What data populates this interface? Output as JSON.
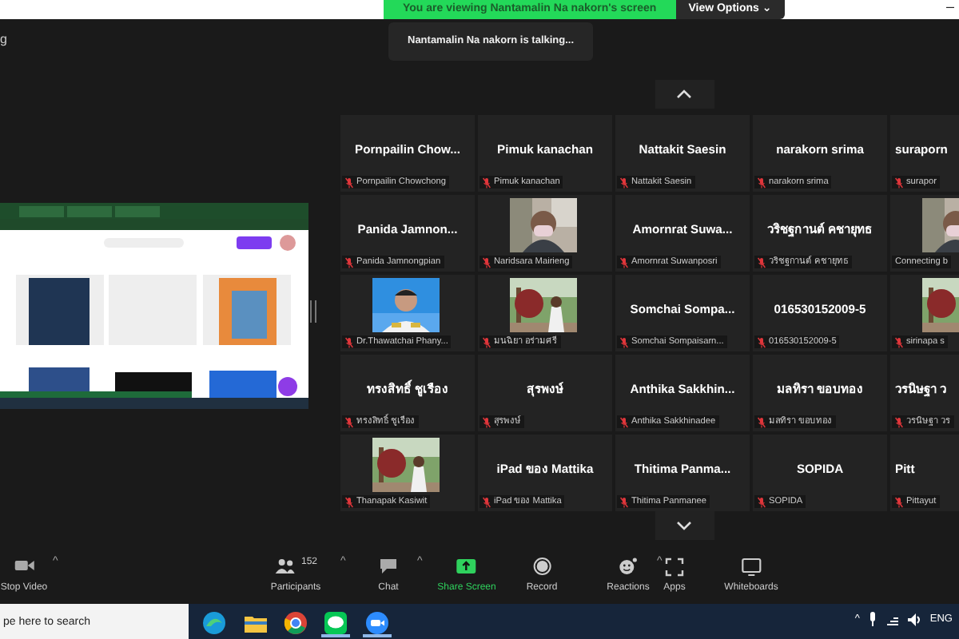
{
  "banner": {
    "text": "You are viewing Nantamalin Na nakorn's screen",
    "view_options": "View Options",
    "caret": "⌄"
  },
  "window_controls": {
    "minimize": "–"
  },
  "title_fragment": "g",
  "toast": "Nantamalin Na nakorn is talking...",
  "gallery": {
    "tiles": [
      {
        "kind": "name",
        "name": "Pornpailin  Chow...",
        "label": "Pornpailin Chowchong",
        "muted": true
      },
      {
        "kind": "name",
        "name": "Pimuk kanachan",
        "label": "Pimuk kanachan",
        "muted": true
      },
      {
        "kind": "name",
        "name": "Nattakit Saesin",
        "label": "Nattakit Saesin",
        "muted": true
      },
      {
        "kind": "name",
        "name": "narakorn srima",
        "label": "narakorn srima",
        "muted": true
      },
      {
        "kind": "name",
        "name": "suraporn",
        "label": "surapor",
        "muted": true
      },
      {
        "kind": "name",
        "name": "Panida  Jamnon...",
        "label": "Panida Jamnongpian",
        "muted": true
      },
      {
        "label": "Naridsara Mairieng",
        "muted": true
      },
      {
        "kind": "name",
        "name": "Amornrat  Suwa...",
        "label": "Amornrat Suwanposri",
        "muted": true
      },
      {
        "kind": "name",
        "name": "วริชฐกานต์ คชายุทธ",
        "label": "วริชฐกานต์ คชายุทธ",
        "muted": true
      },
      {
        "label": "Connecting b",
        "muted": false
      },
      {
        "label": "Dr.Thawatchai Phany...",
        "muted": true
      },
      {
        "label": "มนฉิยา อร่ามศรี",
        "muted": true
      },
      {
        "kind": "name",
        "name": "Somchai  Sompa...",
        "label": "Somchai Sompaisarn...",
        "muted": true
      },
      {
        "kind": "name",
        "name": "016530152009-5",
        "label": "016530152009-5",
        "muted": true
      },
      {
        "label": "sirinapa s",
        "muted": true
      },
      {
        "kind": "name",
        "name": "ทรงสิทธิ์ ชูเรือง",
        "label": "ทรงสิทธิ์ ชูเรือง",
        "muted": true
      },
      {
        "kind": "name",
        "name": "สุรพงษ์",
        "label": "สุรพงษ์",
        "muted": true
      },
      {
        "kind": "name",
        "name": "Anthika  Sakkhin...",
        "label": "Anthika Sakkhinadee",
        "muted": true
      },
      {
        "kind": "name",
        "name": "มลทิรา ขอบทอง",
        "label": "มลทิรา ขอบทอง",
        "muted": true
      },
      {
        "kind": "name",
        "name": "วรนิษฐา ว",
        "label": "วรนิษฐา วร",
        "muted": true
      },
      {
        "label": "Thanapak Kasiwit",
        "muted": true
      },
      {
        "kind": "name",
        "name": "iPad ของ Mattika",
        "label": "iPad ของ Mattika",
        "muted": true
      },
      {
        "kind": "name",
        "name": "Thitima  Panma...",
        "label": "Thitima  Panmanee",
        "muted": true
      },
      {
        "kind": "name",
        "name": "SOPIDA",
        "label": "SOPIDA",
        "muted": true
      },
      {
        "kind": "name",
        "name": "Pitt",
        "label": "Pittayut",
        "muted": true
      }
    ]
  },
  "toolbar": [
    {
      "kind": "video",
      "label": "Stop Video",
      "caret": "^",
      "highlighted": false
    },
    {
      "kind": "participants",
      "label": "Participants",
      "count": "152",
      "caret": "^",
      "highlighted": false
    },
    {
      "kind": "chat",
      "label": "Chat",
      "caret": "^",
      "highlighted": false
    },
    {
      "kind": "share",
      "label": "Share Screen",
      "highlighted": true
    },
    {
      "kind": "record",
      "label": "Record",
      "highlighted": false
    },
    {
      "kind": "reactions",
      "label": "Reactions",
      "caret": "^",
      "highlighted": false
    },
    {
      "kind": "apps",
      "label": "Apps",
      "highlighted": false
    },
    {
      "kind": "whiteboards",
      "label": "Whiteboards",
      "highlighted": false
    }
  ],
  "taskbar": {
    "search": {
      "placeholder": "pe here to search"
    },
    "apps": [
      {
        "kind": "edge",
        "running": false
      },
      {
        "kind": "folder",
        "running": false
      },
      {
        "kind": "chrome",
        "running": false
      },
      {
        "kind": "line",
        "running": true
      },
      {
        "kind": "zoom",
        "running": true
      }
    ],
    "tray": {
      "caret": "^",
      "language": "ENG"
    }
  }
}
